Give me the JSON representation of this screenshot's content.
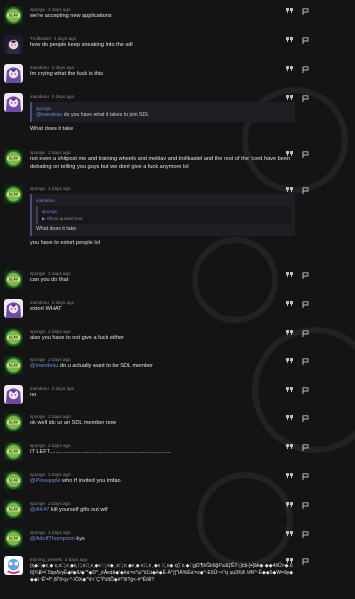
{
  "posts": [
    {
      "author": "sponge",
      "date": "2 days ago",
      "avatar": "sponge",
      "text": "we're accepting new applications"
    },
    {
      "author": "Trollkastel",
      "date": "2 days ago",
      "avatar": "anime1",
      "text": "how do people keep sneaking into the sdl"
    },
    {
      "author": "inandesu",
      "date": "2 days ago",
      "avatar": "anime2",
      "text": "Im crying what the fuck is this"
    },
    {
      "author": "inandesu",
      "date": "2 days ago",
      "avatar": "anime2",
      "quote_author": "sponge",
      "quote_mention": "@inandesu",
      "quote_text": " do you have what it takes to join SDL",
      "text": "What does it take"
    },
    {
      "author": "sponge",
      "date": "2 days ago",
      "avatar": "sponge",
      "text": "not even a shitpost me and training wheels and meklav and trollkastel and the rest of the 'cord have been debating on telling you guys but we dont give a fuck anymore lol"
    },
    {
      "author": "sponge",
      "date": "2 days ago",
      "avatar": "sponge",
      "quote_author": "inandesu",
      "nested_quote_author": "sponge",
      "nested_toggle": "▶ Show quoted text",
      "quote_text": "What does it take",
      "text": "you have to extort people lol"
    },
    {
      "author": "sponge",
      "date": "2 days ago",
      "avatar": "sponge",
      "text": "can you do that"
    },
    {
      "author": "inandesu",
      "date": "2 days ago",
      "avatar": "anime2",
      "text": "extort WHAT"
    },
    {
      "author": "sponge",
      "date": "2 days ago",
      "avatar": "sponge",
      "text": "also you have to not give a fuck either"
    },
    {
      "author": "sponge",
      "date": "2 days ago",
      "avatar": "sponge",
      "mention": "@inandesu",
      "text": " do u actually want to be SDL member"
    },
    {
      "author": "inandesu",
      "date": "2 days ago",
      "avatar": "anime2",
      "text": "no"
    },
    {
      "author": "sponge",
      "date": "2 days ago",
      "avatar": "sponge",
      "text": "ok well idc ur an SDL member now"
    },
    {
      "author": "sponge",
      "date": "2 days ago",
      "avatar": "sponge",
      "text": "IT LEFT.............................................................................."
    },
    {
      "author": "sponge",
      "date": "2 days ago",
      "avatar": "sponge",
      "mention": "@Pineapple",
      "text": " who tf invited you lmfao"
    },
    {
      "author": "sponge",
      "date": "2 days ago",
      "avatar": "sponge",
      "mention": "@AK47",
      "text": " kill yourself gtfo out wtf"
    },
    {
      "author": "sponge",
      "date": "2 days ago",
      "avatar": "sponge",
      "mention": "@AdolfThompson",
      "text": " kys"
    },
    {
      "author": "training_wheels",
      "date": "2 days ago",
      "avatar": "wheels",
      "text": "(ͼ͔◆◆͔◆ͼ͔ ◆ ͼ͔ ͼ◆͔ ͼ ͔◆ͼ͔ ◆͔ ͼ◆͔ ͼ ͔◆ͼ ◆͔ ͼ◆ ͔ ͼ◆͔ ͼ ͔◆ͼ ͔◆ ͼ◆͔ ͼ ͔ ◆ͼ ◆͔ ͼ◆ ͼ͔(\\`ͼ.◆◆͔gD'¶ĕĞbŭĝF\\uЩ'Ĕ7-;}cb-}•{āk◆-◆◆4ŏŮ>◆.ΰß]¾Ɇ=\\`0qoδvγĔ◆f◆ß/◆\"*◆D^_éÅĸdā◆ʹ◆ĕaʹ=ε°ώ^ûĽù◆ĕ◆Ë-Ä^|{\"ΙÀ%Ëaʹ=z◆^-ΕδÛ~<\"ϵj uu3©∂\\ \\#R^-Ë◆◆5◆W=ãγ◆◆◆\\ ⁽Ĕ'=ĺ^,ôĺ\"ð<ρ-^-\\ÒΧ◆^\\ť<`Ç'Ÿ\\ťŏĎ◆#!\"ŝI?ǵ<-#^ĔôĺΙ?"
    }
  ]
}
